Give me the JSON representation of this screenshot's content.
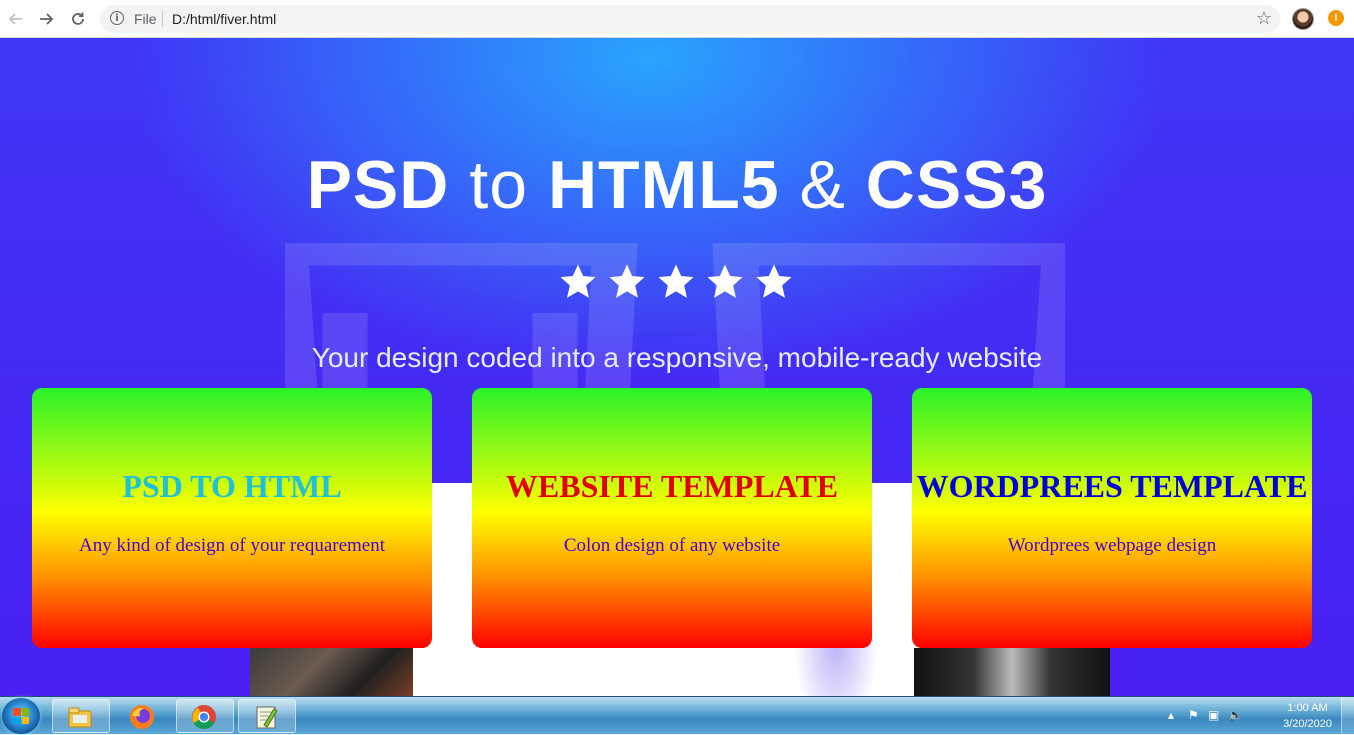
{
  "browser": {
    "back_icon": "arrow-left-icon",
    "forward_icon": "arrow-right-icon",
    "reload_icon": "reload-icon",
    "file_label": "File",
    "url": "D:/html/fiver.html",
    "bookmark_icon": "star-icon",
    "update_icon": "exclamation-icon",
    "update_color": "#f29900"
  },
  "hero": {
    "title_psd": "PSD",
    "title_to": "to",
    "title_html": "HTML5",
    "title_amp": "&",
    "title_css": "CSS3",
    "rating": 5,
    "subtitle": "Your design coded into a responsive, mobile-ready website",
    "background_colors": [
      "#28aaff",
      "#4a20f3"
    ]
  },
  "cards": [
    {
      "title": "PSD TO HTML",
      "text": "Any kind of design of your requarement",
      "title_color": "#1fc1d6"
    },
    {
      "title": "WEBSITE TEMPLATE",
      "text": "Colon design of any website",
      "title_color": "#e00000"
    },
    {
      "title": "WORDPREES TEMPLATE",
      "text": "Wordprees webpage design",
      "title_color": "#0000d8"
    }
  ],
  "card_gradient": [
    "#2af229",
    "#ffff00",
    "#ff8a00",
    "#ff0000"
  ],
  "taskbar": {
    "apps": [
      "windows-explorer-icon",
      "firefox-icon",
      "chrome-icon",
      "notepad-plus-plus-icon"
    ],
    "tray_icons": [
      "show-hidden-icons-arrow",
      "action-center-flag-icon",
      "network-icon",
      "volume-icon"
    ],
    "time": "1:00 AM",
    "date": "3/20/2020"
  }
}
